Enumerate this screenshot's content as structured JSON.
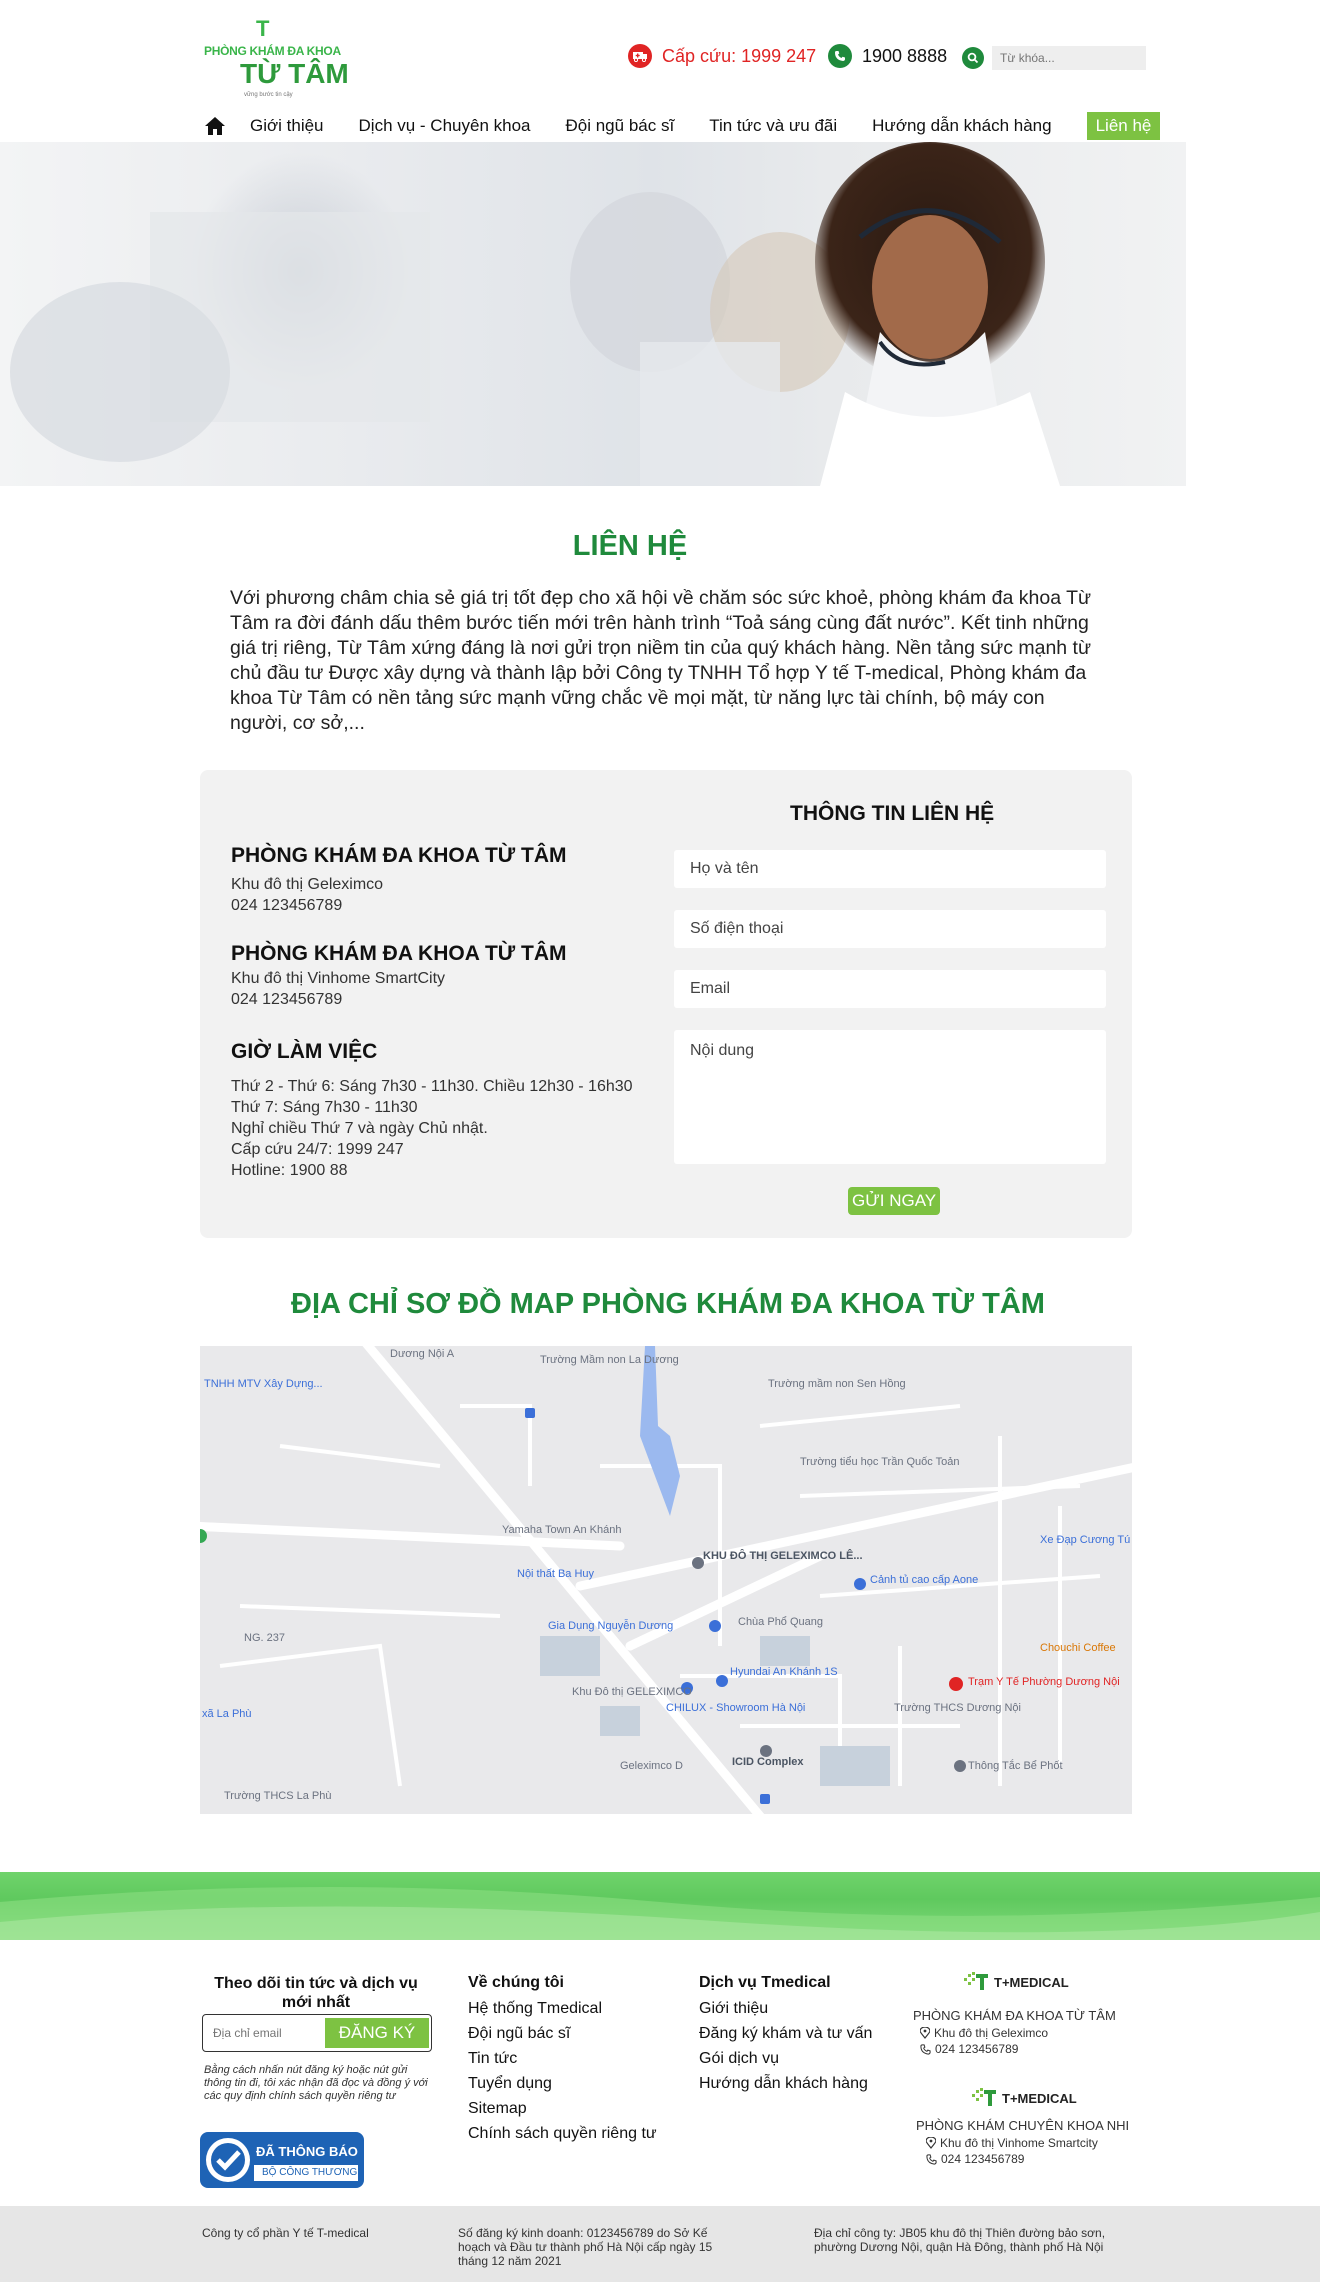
{
  "header": {
    "logo": {
      "mark": "T",
      "line1": "PHÒNG KHÁM ĐA KHOA",
      "line2": "TỪ TÂM",
      "line3": "vững bước tin cậy"
    },
    "emergency": "Cấp cứu: 1999 247",
    "hotline": "1900 8888",
    "search_placeholder": "Từ khóa..."
  },
  "nav": {
    "items": [
      "Giới thiệu",
      "Dịch vụ - Chuyên khoa",
      "Đội ngũ bác sĩ",
      "Tin tức và ưu đãi",
      "Hướng dẫn khách hàng",
      "Liên hệ"
    ],
    "active": "Liên hệ"
  },
  "intro": {
    "title": "LIÊN HỆ",
    "text": "Với phương châm chia sẻ giá trị tốt đẹp cho xã hội về chăm sóc sức khoẻ, phòng khám đa khoa Từ Tâm ra đời đánh dấu thêm bước tiến mới trên hành trình “Toả sáng cùng đất nước”. Kết tinh những giá trị riêng, Từ Tâm xứng đáng là nơi gửi trọn niềm tin của quý khách hàng. Nền tảng sức mạnh từ chủ đầu tư Được xây dựng và thành lập bởi Công ty TNHH Tổ hợp Y tế T-medical, Phòng khám đa khoa Từ Tâm có nền tảng sức mạnh vững chắc về mọi mặt, từ năng lực tài chính, bộ máy con người, cơ sở,..."
  },
  "contact": {
    "clinics": [
      {
        "name": "PHÒNG KHÁM ĐA KHOA TỪ TÂM",
        "address": "Khu đô thị Geleximco",
        "phone": "024 123456789"
      },
      {
        "name": "PHÒNG KHÁM ĐA KHOA TỪ TÂM",
        "address": "Khu đô thị Vinhome SmartCity",
        "phone": "024 123456789"
      }
    ],
    "hours_title": "GIỜ LÀM VIỆC",
    "hours": [
      "Thứ 2 - Thứ 6: Sáng 7h30 - 11h30. Chiều 12h30 - 16h30",
      "Thứ 7: Sáng 7h30 - 11h30",
      "Nghỉ chiều Thứ 7 và ngày Chủ nhật.",
      "Cấp cứu 24/7: 1999 247",
      "Hotline: 1900 88"
    ],
    "form": {
      "title": "THÔNG TIN LIÊN HỆ",
      "name_placeholder": "Họ và tên",
      "phone_placeholder": "Số điện thoại",
      "email_placeholder": "Email",
      "message_placeholder": "Nội dung",
      "submit": "GỬI NGAY"
    }
  },
  "map": {
    "title": "ĐỊA CHỈ SƠ ĐỒ MAP PHÒNG KHÁM ĐA KHOA TỪ TÂM",
    "labels": [
      "Dương Nội A",
      "Trường Mầm non La Dương",
      "TNHH MTV Xây Dựng...",
      "Trường mầm non Sen Hồng",
      "Trường tiểu học Trần Quốc Toản",
      "Yamaha Town An Khánh",
      "KHU ĐÔ THỊ GELEXIMCO LÊ...",
      "Xe Đạp Cương Tú",
      "Nội thất Ba Huy",
      "Cảnh tủ cao cấp Aone",
      "Gia Dụng Nguyễn Dương",
      "Chùa Phổ Quang",
      "Chouchi Coffee",
      "Hyundai An Khánh 1S",
      "Trạm Y Tế Phường Dương Nội",
      "Khu Đô thị GELEXIMCO",
      "CHILUX - Showroom Hà Nội",
      "Trường THCS Dương Nội",
      "Geleximco D",
      "ICID Complex",
      "Thông Tắc Bể Phốt",
      "xã La Phù",
      "Trường THCS La Phù",
      "NG. 237"
    ]
  },
  "footer": {
    "subscribe": {
      "title": "Theo dõi tin tức và dịch vụ mới nhất",
      "placeholder": "Địa chỉ email",
      "button": "ĐĂNG KÝ",
      "note": "Bằng cách nhấn nút đăng ký hoặc nút gửi thông tin đi, tôi xác nhận đã đọc và đồng ý với các quy định chính sách quyền riêng tư"
    },
    "badge": {
      "top": "ĐÃ THÔNG BÁO",
      "bottom": "BỘ CÔNG THƯƠNG"
    },
    "about": {
      "title": "Về chúng tôi",
      "links": [
        "Hệ thống Tmedical",
        "Đội ngũ bác sĩ",
        "Tin tức",
        "Tuyển dụng",
        "Sitemap",
        "Chính sách quyền riêng tư"
      ]
    },
    "services": {
      "title": "Dịch vụ Tmedical",
      "links": [
        "Giới thiệu",
        "Đăng ký khám và tư vấn",
        "Gói dịch vụ",
        "Hướng dẫn khách hàng"
      ]
    },
    "branches": [
      {
        "brand": "T+MEDICAL",
        "name": "PHÒNG KHÁM ĐA KHOA TỪ TÂM",
        "address": "Khu đô thị Geleximco",
        "phone": "024 123456789"
      },
      {
        "brand": "T+MEDICAL",
        "name": "PHÒNG KHÁM CHUYÊN KHOA NHI",
        "address": "Khu đô thị Vinhome Smartcity",
        "phone": "024 123456789"
      }
    ],
    "bottom": {
      "company": "Công ty cổ phần Y tế T-medical",
      "license": "Số đăng ký kinh doanh: 0123456789 do Sở Kế hoạch và Đầu tư thành phố Hà Nội cấp ngày 15 tháng 12 năm 2021",
      "address": "Địa chỉ công ty: JB05 khu đô thị Thiên đường bảo sơn, phường Dương Nội, quận Hà Đông, thành phố Hà Nội"
    }
  },
  "colors": {
    "brand_green": "#1f8a3c",
    "accent_green": "#7dc242",
    "emergency_red": "#e02424"
  }
}
